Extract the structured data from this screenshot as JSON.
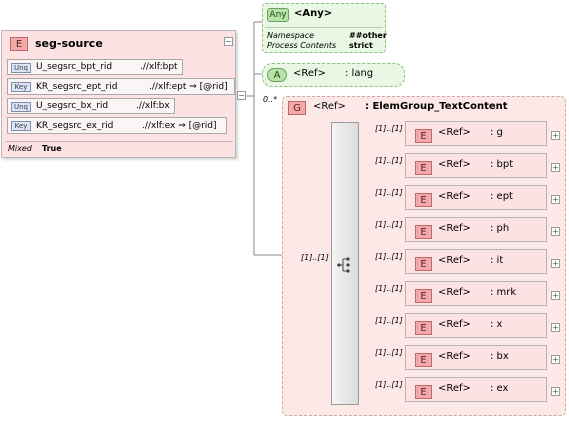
{
  "seg_source": {
    "badge": "E",
    "title": "seg-source",
    "collapse": "−",
    "keys": [
      {
        "badge": "Unq",
        "name": "U_segsrc_bpt_rid",
        "path": ".//xlf:bpt"
      },
      {
        "badge": "Key",
        "name": "KR_segsrc_ept_rid",
        "path": ".//xlf:ept ⇒ [@rid]"
      },
      {
        "badge": "Unq",
        "name": "U_segsrc_bx_rid",
        "path": ".//xlf:bx"
      },
      {
        "badge": "Key",
        "name": "KR_segsrc_ex_rid",
        "path": ".//xlf:ex ⇒ [@rid]"
      }
    ],
    "mixed_label": "Mixed",
    "mixed_value": "True",
    "seq_collapse": "−"
  },
  "any": {
    "badge": "Any",
    "title": "<Any>",
    "namespace_label": "Namespace",
    "namespace_value": "##other",
    "process_label": "Process Contents",
    "process_value": "strict"
  },
  "attr": {
    "badge": "A",
    "ref": "<Ref>",
    "name": ": lang"
  },
  "occurs_any": "0..*",
  "group": {
    "badge": "G",
    "ref": "<Ref>",
    "name": ": ElemGroup_TextContent",
    "choice_occurs": "[1]..[1]",
    "items": [
      {
        "occurs": "[1]..[1]",
        "badge": "E",
        "ref": "<Ref>",
        "name": ": g"
      },
      {
        "occurs": "[1]..[1]",
        "badge": "E",
        "ref": "<Ref>",
        "name": ": bpt"
      },
      {
        "occurs": "[1]..[1]",
        "badge": "E",
        "ref": "<Ref>",
        "name": ": ept"
      },
      {
        "occurs": "[1]..[1]",
        "badge": "E",
        "ref": "<Ref>",
        "name": ": ph"
      },
      {
        "occurs": "[1]..[1]",
        "badge": "E",
        "ref": "<Ref>",
        "name": ": it"
      },
      {
        "occurs": "[1]..[1]",
        "badge": "E",
        "ref": "<Ref>",
        "name": ": mrk"
      },
      {
        "occurs": "[1]..[1]",
        "badge": "E",
        "ref": "<Ref>",
        "name": ": x"
      },
      {
        "occurs": "[1]..[1]",
        "badge": "E",
        "ref": "<Ref>",
        "name": ": bx"
      },
      {
        "occurs": "[1]..[1]",
        "badge": "E",
        "ref": "<Ref>",
        "name": ": ex"
      }
    ],
    "expand": "+"
  },
  "colors": {
    "element_fill": "#fce2e2",
    "group_fill": "#fde8e8",
    "any_fill": "#e9f7e4",
    "connector": "#8a8a8a"
  }
}
